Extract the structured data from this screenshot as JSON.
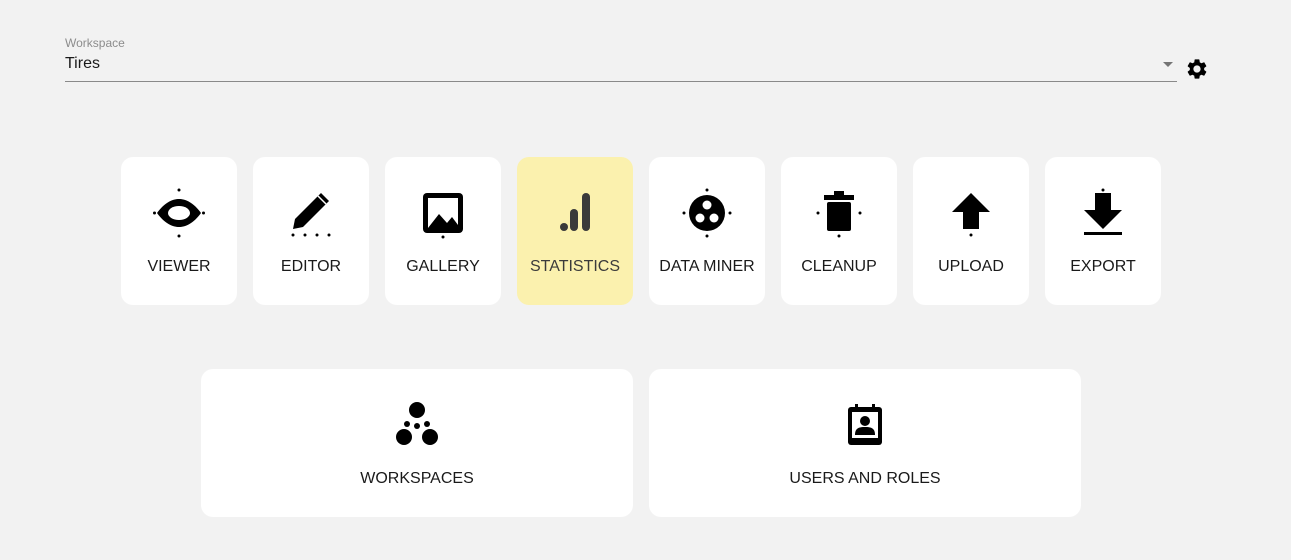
{
  "workspace": {
    "label": "Workspace",
    "value": "Tires"
  },
  "tools": [
    {
      "label": "VIEWER",
      "icon": "eye-icon"
    },
    {
      "label": "EDITOR",
      "icon": "pencil-icon"
    },
    {
      "label": "GALLERY",
      "icon": "image-icon"
    },
    {
      "label": "STATISTICS",
      "icon": "bar-chart-icon",
      "active": true
    },
    {
      "label": "DATA MINER",
      "icon": "data-miner-icon"
    },
    {
      "label": "CLEANUP",
      "icon": "trash-icon"
    },
    {
      "label": "UPLOAD",
      "icon": "upload-arrow-icon"
    },
    {
      "label": "EXPORT",
      "icon": "download-arrow-icon"
    }
  ],
  "admin": [
    {
      "label": "WORKSPACES",
      "icon": "bubbles-icon"
    },
    {
      "label": "USERS AND ROLES",
      "icon": "contact-badge-icon"
    }
  ],
  "colors": {
    "background": "#f2f2f2",
    "tile": "#ffffff",
    "active_tile": "#fbf1ae",
    "icon": "#000000"
  }
}
